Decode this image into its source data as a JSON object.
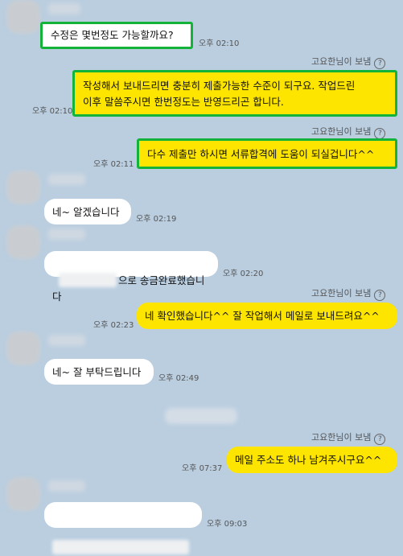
{
  "sender_label": "고요한님이 보냄",
  "help_icon": "question-circle-icon",
  "messages": [
    {
      "text": "수정은 몇번정도 가능할까요?",
      "time": "오후 02:10"
    },
    {
      "text": "작성해서 보내드리면 충분히 제출가능한 수준이 되구요. 작업드린\n이후 말씀주시면 한번정도는 반영드리곤 합니다.",
      "time": "오후 02:10"
    },
    {
      "text": "다수 제출만 하시면 서류합격에 도움이 되실겁니다^^",
      "time": "오후 02:11"
    },
    {
      "text": "네~ 알겠습니다",
      "time": "오후 02:19"
    },
    {
      "text": "으로 송금완료했습니다",
      "time": "오후 02:20"
    },
    {
      "text": "네 확인했습니다^^ 잘 작업해서 메일로 보내드려요^^",
      "time": "오후 02:23"
    },
    {
      "text": "네~ 잘 부탁드립니다",
      "time": "오후 02:49"
    },
    {
      "text": "메일 주소도 하나 남겨주시구요^^",
      "time": "오후 07:37"
    },
    {
      "text": "",
      "time": "오후 09:03"
    }
  ],
  "colors": {
    "background": "#bacee0",
    "outgoing": "#fee500",
    "incoming": "#ffffff",
    "highlight": "#13b33a"
  }
}
